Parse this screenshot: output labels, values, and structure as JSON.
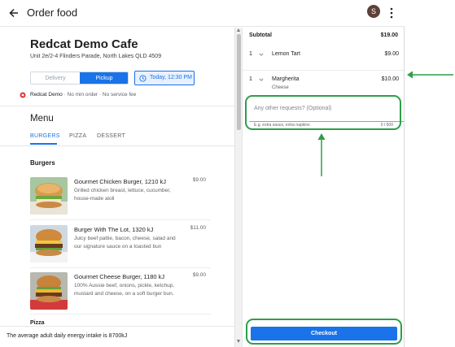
{
  "header": {
    "title": "Order food",
    "avatar_letter": "S"
  },
  "store": {
    "name": "Redcat Demo Cafe",
    "address": "Unit 2e/2-4 Flinders Parade, North Lakes QLD 4509",
    "delivery_label": "Delivery",
    "pickup_label": "Pickup",
    "time_label": "Today, 12:30 PM",
    "vendor_name": "Redcat Demo",
    "vendor_meta": " · No min order · No service fee"
  },
  "menu": {
    "title": "Menu",
    "tabs": [
      {
        "label": "BURGERS"
      },
      {
        "label": "PIZZA"
      },
      {
        "label": "DESSERT"
      }
    ],
    "section_burgers": "Burgers",
    "items": [
      {
        "name": "Gourmet Chicken Burger,  1210 kJ",
        "desc": "Grilled chicken breast, lettuce, cucumber, house-made aioli",
        "price": "$9.00"
      },
      {
        "name": "Burger With The Lot,  1320 kJ",
        "desc": "Juicy beef pattie, bacon, cheese, salad and our signature sauce on a toasted bun",
        "price": "$11.00"
      },
      {
        "name": "Gourmet Cheese Burger,  1180 kJ",
        "desc": "100% Aussie beef, onions, pickle, ketchup, mustard and cheese, on a soft burger bun.",
        "price": "$9.00"
      }
    ],
    "section_pizza": "Pizza",
    "energy_note": "The average adult daily energy intake is 8700kJ"
  },
  "cart": {
    "subtotal_label": "Subtotal",
    "subtotal_value": "$19.00",
    "lines": [
      {
        "qty": "1",
        "name": "Lemon Tart",
        "sub": "",
        "price": "$9.00"
      },
      {
        "qty": "1",
        "name": "Margherita",
        "sub": "Cheese",
        "price": "$10.00"
      }
    ],
    "requests_placeholder": "Any other requests? (Optional)",
    "requests_hint": "E.g. extra sauce, extra napkins",
    "requests_counter": "0 / 500",
    "checkout_label": "Checkout"
  },
  "colors": {
    "accent": "#1a73e8",
    "annotation": "#2e9e48"
  }
}
